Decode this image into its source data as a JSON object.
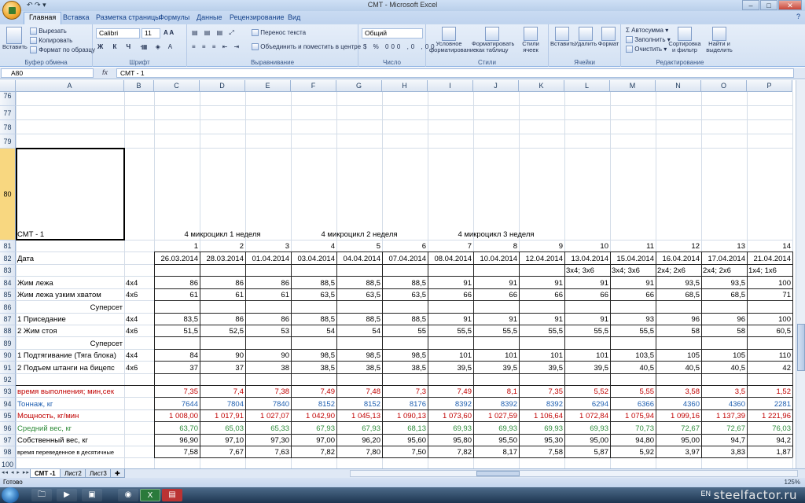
{
  "window": {
    "title": "СМТ - Microsoft Excel",
    "buttons": [
      "–",
      "□",
      "✕"
    ]
  },
  "quick_access": "↶ ↷ ▾",
  "ribbon_tabs": [
    "Главная",
    "Вставка",
    "Разметка страницы",
    "Формулы",
    "Данные",
    "Рецензирование",
    "Вид"
  ],
  "ribbon": {
    "clipboard": {
      "paste": "Вставить",
      "cut": "Вырезать",
      "copy": "Копировать",
      "format_painter": "Формат по образцу",
      "label": "Буфер обмена"
    },
    "font": {
      "name": "Calibri",
      "size": "11",
      "label": "Шрифт"
    },
    "alignment": {
      "wrap": "Перенос текста",
      "merge": "Объединить и поместить в центре",
      "label": "Выравнивание"
    },
    "number": {
      "format": "Общий",
      "label": "Число"
    },
    "styles": {
      "conditional": "Условное форматирование",
      "table": "Форматировать как таблицу",
      "cell_styles": "Стили ячеек",
      "label": "Стили"
    },
    "cells": {
      "insert": "Вставить",
      "delete": "Удалить",
      "format": "Формат",
      "label": "Ячейки"
    },
    "editing": {
      "autosum": "Автосумма",
      "fill": "Заполнить",
      "clear": "Очистить",
      "sort": "Сортировка и фильтр",
      "find": "Найти и выделить",
      "label": "Редактирование"
    }
  },
  "formula_bar": {
    "name_box": "A80",
    "fx": "fx",
    "content": "СМТ - 1"
  },
  "columns": [
    "A",
    "B",
    "C",
    "D",
    "E",
    "F",
    "G",
    "H",
    "I",
    "J",
    "K",
    "L",
    "M",
    "N",
    "O",
    "P"
  ],
  "rows": [
    76,
    77,
    78,
    79,
    80,
    81,
    82,
    83,
    84,
    85,
    86,
    87,
    88,
    89,
    90,
    91,
    92,
    93,
    94,
    95,
    96,
    97,
    98,
    100
  ],
  "cells": {
    "a80": "СМТ - 1",
    "microcycles": [
      "4  микроцикл 1 неделя",
      "4  микроцикл 2 неделя",
      "4  микроцикл 3 неделя"
    ],
    "day_numbers": [
      "1",
      "2",
      "3",
      "4",
      "5",
      "6",
      "7",
      "8",
      "9",
      "10",
      "11",
      "12",
      "13",
      "14"
    ],
    "date_label": "Дата",
    "dates": [
      "26.03.2014",
      "28.03.2014",
      "01.04.2014",
      "03.04.2014",
      "04.04.2014",
      "07.04.2014",
      "08.04.2014",
      "10.04.2014",
      "12.04.2014",
      "13.04.2014",
      "15.04.2014",
      "16.04.2014",
      "17.04.2014",
      "21.04.2014"
    ],
    "schemes": [
      "3x4; 3x6",
      "3x4; 3x6",
      "2x4; 2x6",
      "2x4; 2x6",
      "1x4; 1x6"
    ],
    "superset1": "Суперсет",
    "superset2": "Суперсет",
    "exercises": [
      {
        "name": "Жим лежа",
        "reps": "4x4",
        "vals": [
          "86",
          "86",
          "86",
          "88,5",
          "88,5",
          "88,5",
          "91",
          "91",
          "91",
          "91",
          "91",
          "93,5",
          "93,5",
          "100"
        ]
      },
      {
        "name": "Жим лежа узким хватом",
        "reps": "4x6",
        "vals": [
          "61",
          "61",
          "61",
          "63,5",
          "63,5",
          "63,5",
          "66",
          "66",
          "66",
          "66",
          "66",
          "68,5",
          "68,5",
          "71"
        ]
      },
      {
        "name": "1   Приседание",
        "reps": "4x4",
        "vals": [
          "83,5",
          "86",
          "86",
          "88,5",
          "88,5",
          "88,5",
          "91",
          "91",
          "91",
          "91",
          "93",
          "96",
          "96",
          "100"
        ]
      },
      {
        "name": "2   Жим стоя",
        "reps": "4x6",
        "vals": [
          "51,5",
          "52,5",
          "53",
          "54",
          "54",
          "55",
          "55,5",
          "55,5",
          "55,5",
          "55,5",
          "55,5",
          "58",
          "58",
          "60,5"
        ]
      },
      {
        "name": "1 Подтягивание (Тяга блока)",
        "reps": "4x4",
        "vals": [
          "84",
          "90",
          "90",
          "98,5",
          "98,5",
          "98,5",
          "101",
          "101",
          "101",
          "101",
          "103,5",
          "105",
          "105",
          "110"
        ]
      },
      {
        "name": "2 Подъем штанги на бицепс",
        "reps": "4x6",
        "vals": [
          "37",
          "37",
          "38",
          "38,5",
          "38,5",
          "38,5",
          "39,5",
          "39,5",
          "39,5",
          "39,5",
          "40,5",
          "40,5",
          "40,5",
          "42"
        ]
      }
    ],
    "stats": [
      {
        "name": "время выполнения; мин,сек",
        "color": "#c00000",
        "vals": [
          "7,35",
          "7,4",
          "7,38",
          "7,49",
          "7,48",
          "7,3",
          "7,49",
          "8,1",
          "7,35",
          "5,52",
          "5,55",
          "3,58",
          "3,5",
          "1,52"
        ]
      },
      {
        "name": "Тоннаж, кг",
        "color": "#1f5fb0",
        "vals": [
          "7644",
          "7804",
          "7840",
          "8152",
          "8152",
          "8176",
          "8392",
          "8392",
          "8392",
          "6294",
          "6366",
          "4360",
          "4360",
          "2281"
        ]
      },
      {
        "name": "Мощность, кг/мин",
        "color": "#c00000",
        "vals": [
          "1 008,00",
          "1 017,91",
          "1 027,07",
          "1 042,90",
          "1 045,13",
          "1 090,13",
          "1 073,60",
          "1 027,59",
          "1 106,64",
          "1 072,84",
          "1 075,94",
          "1 099,16",
          "1 137,39",
          "1 221,96"
        ]
      },
      {
        "name": "Средний вес, кг",
        "color": "#2e8b3a",
        "vals": [
          "63,70",
          "65,03",
          "65,33",
          "67,93",
          "67,93",
          "68,13",
          "69,93",
          "69,93",
          "69,93",
          "69,93",
          "70,73",
          "72,67",
          "72,67",
          "76,03"
        ]
      },
      {
        "name": "Собственный вес, кг",
        "color": "#000000",
        "vals": [
          "96,90",
          "97,10",
          "97,30",
          "97,00",
          "96,20",
          "95,60",
          "95,80",
          "95,50",
          "95,30",
          "95,00",
          "94,80",
          "95,00",
          "94,7",
          "94,2"
        ]
      },
      {
        "name": "время переведенное в десятичные",
        "color": "#000000",
        "small": true,
        "vals": [
          "7,58",
          "7,67",
          "7,63",
          "7,82",
          "7,80",
          "7,50",
          "7,82",
          "8,17",
          "7,58",
          "5,87",
          "5,92",
          "3,97",
          "3,83",
          "1,87"
        ]
      }
    ]
  },
  "sheet_tabs": [
    "СМТ -1",
    "Лист2",
    "Лист3"
  ],
  "status": {
    "ready": "Готово",
    "zoom": "125%"
  },
  "taskbar": {
    "lang": "EN"
  },
  "watermark": "steelfactor.ru"
}
